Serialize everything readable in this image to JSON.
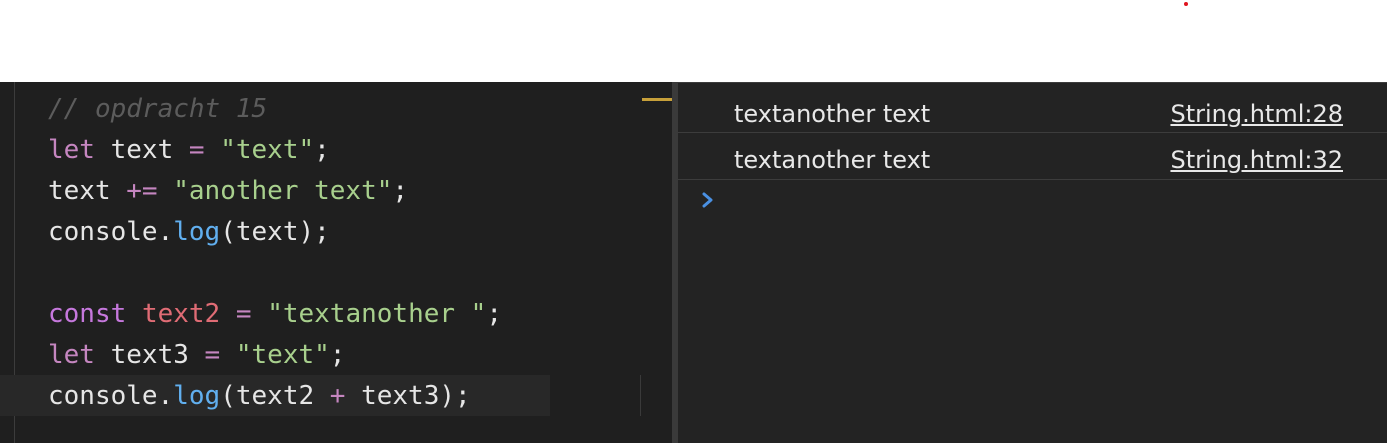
{
  "editor": {
    "lines": [
      {
        "tokens": [
          {
            "t": "// opdracht 15",
            "c": "cm"
          }
        ]
      },
      {
        "tokens": [
          {
            "t": "let",
            "c": "kw"
          },
          {
            "t": " text ",
            "c": "pl"
          },
          {
            "t": "=",
            "c": "op"
          },
          {
            "t": " ",
            "c": "pl"
          },
          {
            "t": "\"text\"",
            "c": "str"
          },
          {
            "t": ";",
            "c": "pl"
          }
        ]
      },
      {
        "tokens": [
          {
            "t": "text ",
            "c": "pl"
          },
          {
            "t": "+=",
            "c": "op"
          },
          {
            "t": " ",
            "c": "pl"
          },
          {
            "t": "\"another text\"",
            "c": "str"
          },
          {
            "t": ";",
            "c": "pl"
          }
        ]
      },
      {
        "tokens": [
          {
            "t": "console",
            "c": "pl"
          },
          {
            "t": ".",
            "c": "pl"
          },
          {
            "t": "log",
            "c": "fn"
          },
          {
            "t": "(text);",
            "c": "pl"
          }
        ]
      },
      {
        "tokens": []
      },
      {
        "tokens": [
          {
            "t": "const",
            "c": "kw2"
          },
          {
            "t": " ",
            "c": "pl"
          },
          {
            "t": "text2",
            "c": "cn"
          },
          {
            "t": " ",
            "c": "pl"
          },
          {
            "t": "=",
            "c": "op"
          },
          {
            "t": " ",
            "c": "pl"
          },
          {
            "t": "\"textanother \"",
            "c": "str"
          },
          {
            "t": ";",
            "c": "pl"
          }
        ]
      },
      {
        "tokens": [
          {
            "t": "let",
            "c": "kw"
          },
          {
            "t": " text3 ",
            "c": "pl"
          },
          {
            "t": "=",
            "c": "op"
          },
          {
            "t": " ",
            "c": "pl"
          },
          {
            "t": "\"text\"",
            "c": "str"
          },
          {
            "t": ";",
            "c": "pl"
          }
        ]
      },
      {
        "tokens": [
          {
            "t": "console",
            "c": "pl"
          },
          {
            "t": ".",
            "c": "pl"
          },
          {
            "t": "log",
            "c": "fn"
          },
          {
            "t": "(text2 ",
            "c": "pl"
          },
          {
            "t": "+",
            "c": "op"
          },
          {
            "t": " text3);",
            "c": "pl"
          }
        ]
      }
    ]
  },
  "console": {
    "messages": [
      {
        "text": "textanother text",
        "source": "String.html:28"
      },
      {
        "text": "textanother text",
        "source": "String.html:32"
      }
    ],
    "prompt_icon": "chevron-right-icon",
    "prompt_color": "#4a90e2"
  },
  "colors": {
    "editor_bg": "#1f1f1f",
    "console_bg": "#232323",
    "accent_marker": "#c7a03a",
    "red_dot": "#e0141e"
  }
}
